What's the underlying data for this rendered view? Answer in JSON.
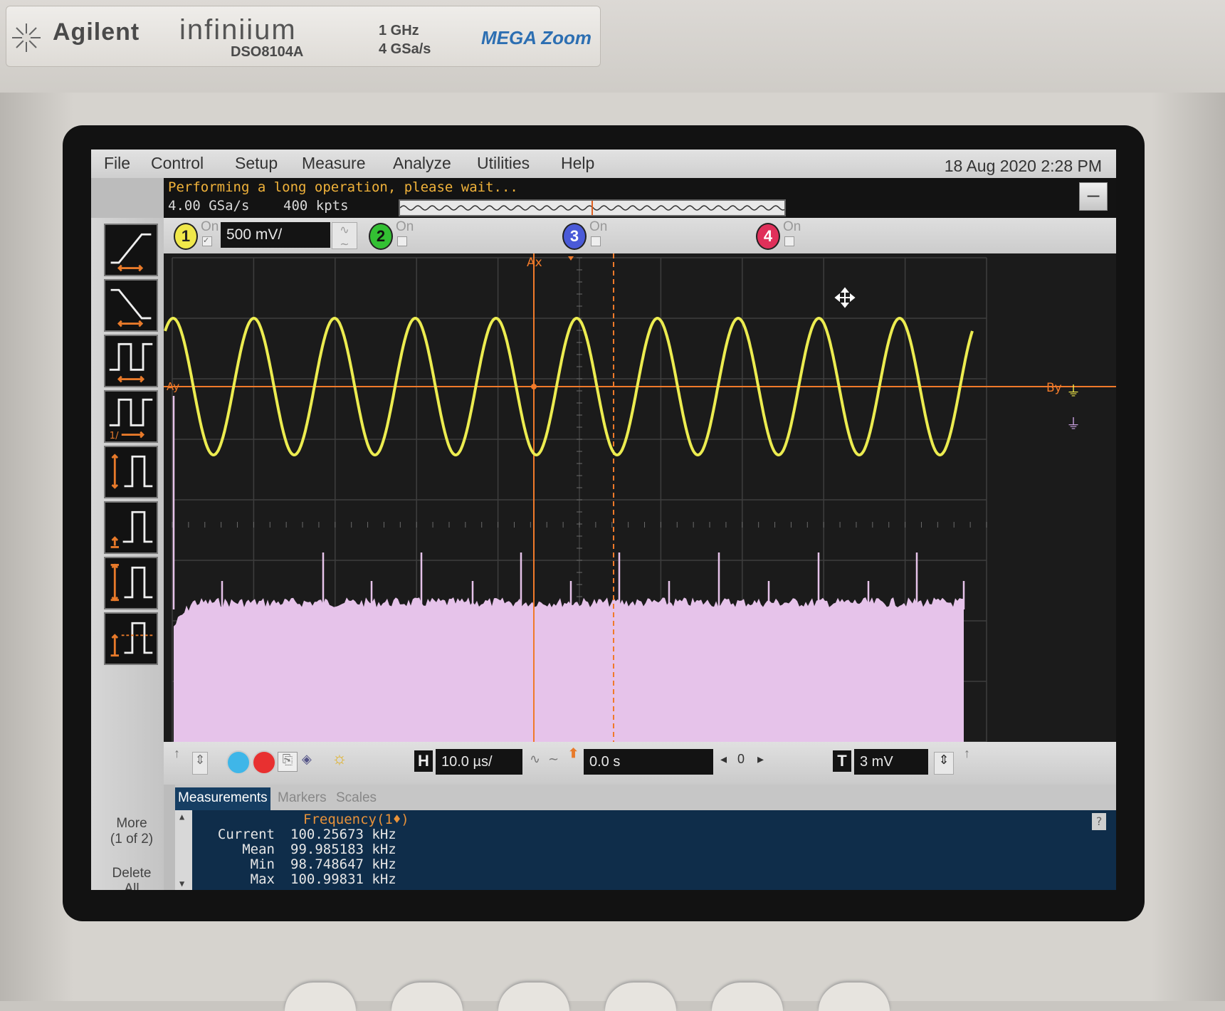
{
  "brand": {
    "company": "Agilent",
    "series": "infiniium",
    "model": "DSO8104A",
    "bandwidth": "1 GHz",
    "sample_rate": "4 GSa/s",
    "feature": "MEGA Zoom"
  },
  "menu": {
    "items": [
      "File",
      "Control",
      "Setup",
      "Measure",
      "Analyze",
      "Utilities",
      "Help"
    ],
    "datetime": "18 Aug 2020  2:28 PM"
  },
  "status": {
    "message": "Performing a long operation, please wait...",
    "sample_rate": "4.00 GSa/s",
    "memory_depth": "400 kpts",
    "minimize_label": "–"
  },
  "channels": [
    {
      "number": "1",
      "on_label": "On",
      "enabled": true,
      "scale": "500 mV/",
      "color": "#e8e04a"
    },
    {
      "number": "2",
      "on_label": "On",
      "enabled": false,
      "color": "#3fbf3f"
    },
    {
      "number": "3",
      "on_label": "On",
      "enabled": false,
      "color": "#4a5ad8"
    },
    {
      "number": "4",
      "on_label": "On",
      "enabled": false,
      "color": "#e0305a"
    }
  ],
  "toolbar": {
    "more_label": "More",
    "more_page": "(1 of 2)",
    "delete_label": "Delete",
    "delete_label2": "All"
  },
  "waveform": {
    "cursor_ax_label": "Ax",
    "cursor_ay_label": "Ay",
    "cursor_by_label": "By",
    "cycles_visible": 10,
    "trace_color": "#ecec50",
    "spectrum_color": "#e6c3ea",
    "cursor_color": "#f07a2a"
  },
  "controls": {
    "horizontal_letter": "H",
    "horizontal_scale": "10.0 µs/",
    "delay": "0.0 s",
    "delay_index": "0",
    "trigger_letter": "T",
    "trigger_level": "3 mV"
  },
  "measurements": {
    "tabs": [
      "Measurements",
      "Markers",
      "Scales"
    ],
    "title": "Frequency(1♦)",
    "rows": [
      {
        "label": "Current",
        "value": "100.25673 kHz"
      },
      {
        "label": "Mean",
        "value": "99.985183 kHz"
      },
      {
        "label": "Min",
        "value": "98.748647 kHz"
      },
      {
        "label": "Max",
        "value": "100.99831 kHz"
      }
    ],
    "help_label": "?"
  }
}
